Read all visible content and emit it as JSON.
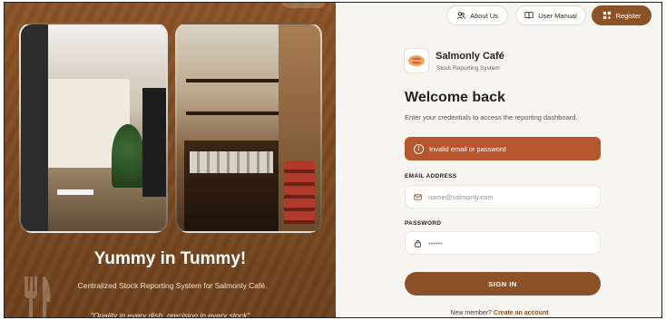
{
  "left_panel": {
    "headline": "Yummy in Tummy!",
    "subline": "Centralized Stock Reporting System for Salmonly Café.",
    "quote": "\"Quality in every dish, precision in every stock\""
  },
  "header": {
    "about_label": "About Us",
    "manual_label": "User Manual",
    "register_label": "Register"
  },
  "brand": {
    "name": "Salmonly Café",
    "tagline": "Stock Reporting System"
  },
  "login": {
    "title": "Welcome back",
    "instructions": "Enter your credentials to access the reporting dashboard.",
    "error_message": "Invalid email or password",
    "email_label": "EMAIL ADDRESS",
    "email_placeholder": "name@salmonly.com",
    "password_label": "PASSWORD",
    "password_placeholder": "••••••",
    "submit_label": "SIGN IN",
    "signup_prompt": "New member?",
    "signup_link": "Create an account"
  },
  "colors": {
    "brand_brown": "#8a5226",
    "error_red": "#b8562e",
    "background": "#f7f5f2"
  },
  "icons": {
    "about": "users-icon",
    "manual": "book-icon",
    "register": "grid-icon",
    "error": "alert-circle-icon",
    "email": "mail-icon",
    "password": "lock-icon"
  }
}
